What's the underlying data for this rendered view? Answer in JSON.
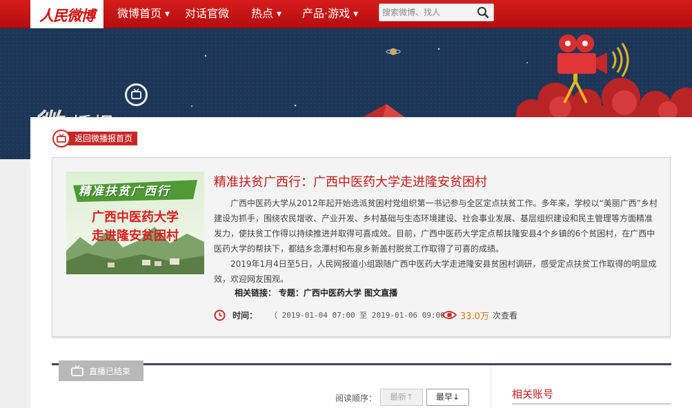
{
  "header": {
    "logo_text": "人民微博",
    "nav": [
      {
        "label": "微博首页",
        "has_caret": true
      },
      {
        "label": "对话官微",
        "has_caret": false
      },
      {
        "label": "热点",
        "has_caret": true
      },
      {
        "label": "产品·游戏",
        "has_caret": true
      }
    ],
    "search_placeholder": "搜索微博、找人"
  },
  "banner": {
    "brand_big": "微",
    "brand_rest": "播报"
  },
  "back_link": "返回微播报首页",
  "item": {
    "thumbnail": {
      "line1": "精准扶贫广西行",
      "line2": "广西中医药大学",
      "line3": "走进隆安贫困村"
    },
    "title": "精准扶贫广西行：广西中医药大学走进隆安贫困村",
    "paragraph1": "广西中医药大学从2012年起开始选派贫困村党组织第一书记参与全区定点扶贫工作。多年来，学校以“美丽广西”乡村建设为抓手，围绕农民增收、产业开发、乡村基础与生态环境建设、社会事业发展、基层组织建设和民主管理等方面精准发力，使扶贫工作得以持续推进并取得可喜成效。目前，广西中医药大学定点帮扶隆安县4个乡镇的6个贫困村，在广西中医药大学的帮扶下，都结乡念潭村和布泉乡新盖村脱贫工作取得了可喜的成绩。",
    "paragraph2": "2019年1月4日至5日，人民网报道小组跟随广西中医药大学走进隆安县贫困村调研，感受定点扶贫工作取得的明显成效，欢迎网友围观。",
    "related_label": "相关链接：",
    "related_links": "专题：广西中医药大学 图文直播",
    "time_label": "时间：",
    "time_value": "（ 2019-01-04 07:00 至 2019-01-06 09:00 ）",
    "views_count": "33.0万",
    "views_unit": "次查看"
  },
  "live": {
    "status": "直播已结束",
    "order_label": "阅读顺序：",
    "btn_newest": "最新↑",
    "btn_oldest": "最早↓"
  },
  "sidebar": {
    "title": "相关账号"
  },
  "colors": {
    "brand_red": "#c21a1a",
    "nav_red": "#c51515",
    "banner_navy": "#1f3a5c",
    "views_orange": "#d87a16"
  }
}
